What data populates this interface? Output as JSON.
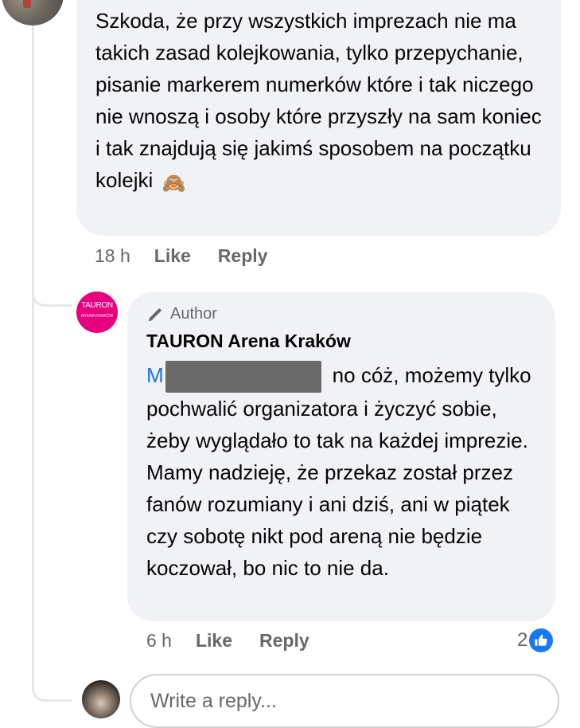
{
  "first_comment": {
    "text": "Szkoda, że przy wszystkich imprezach nie ma takich zasad kolejkowania, tylko przepychanie, pisanie markerem numerków które i tak niczego nie wnoszą i osoby które przyszły na sam koniec i tak znajdują się jakimś sposobem na początku kolejki",
    "emoji": "🙈",
    "time": "18 h",
    "like_label": "Like",
    "reply_label": "Reply"
  },
  "reply_comment": {
    "badge_label": "Author",
    "author_name": "TAURON Arena Kraków",
    "avatar_logo": "TAURON",
    "avatar_logo_sub": "ARENA KRAKÓW",
    "mention_initial": "M",
    "text": "no cóż, możemy tylko pochwalić organizatora i życzyć sobie, żeby wyglądało to tak na każdej imprezie. Mamy nadzieję, że przekaz został przez fanów rozumiany i ani dziś, ani w piątek czy sobotę nikt pod areną nie będzie koczował, bo nic to nie da.",
    "time": "6 h",
    "like_label": "Like",
    "reply_label": "Reply",
    "reaction_count": "2",
    "reaction_icon": "thumbs-up-icon"
  },
  "reply_box": {
    "placeholder": "Write a reply..."
  },
  "colors": {
    "bubble": "#f0f2f5",
    "meta_text": "#65676b",
    "mention": "#1b74e4",
    "like_blue": "#1877f2",
    "tauron_pink": "#e6007e"
  }
}
